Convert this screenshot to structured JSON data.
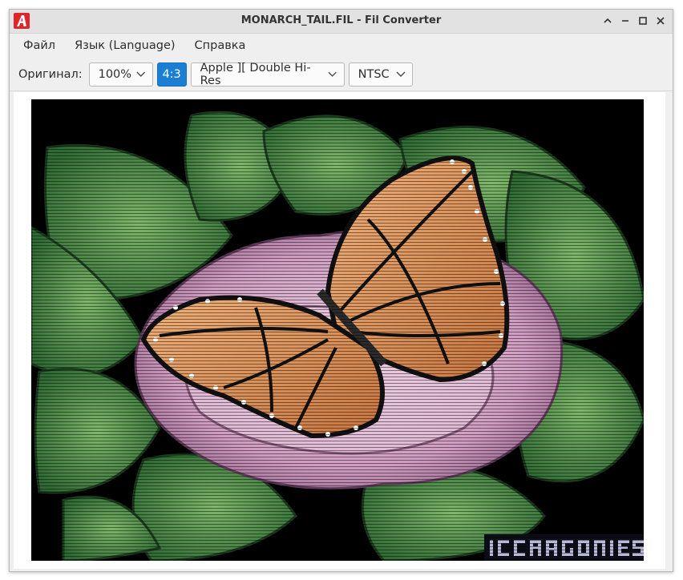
{
  "window": {
    "title": "MONARCH_TAIL.FIL - Fil Converter",
    "icons": {
      "app": "app-logo-icon",
      "collapse": "chevron-up-icon",
      "minimize": "minimize-icon",
      "maximize": "maximize-icon",
      "close": "close-icon"
    }
  },
  "menu": {
    "items": [
      {
        "label": "Файл"
      },
      {
        "label": "Язык (Language)"
      },
      {
        "label": "Справка"
      }
    ]
  },
  "toolbar": {
    "original_label": "Оригинал:",
    "zoom_value": "100%",
    "aspect_label": "4:3",
    "format_value": "Apple ][ Double Hi-Res",
    "video_value": "NTSC"
  },
  "colors": {
    "accent": "#1a7fd4",
    "logo_red": "#e0242b"
  },
  "image": {
    "subject": "monarch butterfly on pink rose with green leaves",
    "watermark": "DCDRAGONS"
  }
}
